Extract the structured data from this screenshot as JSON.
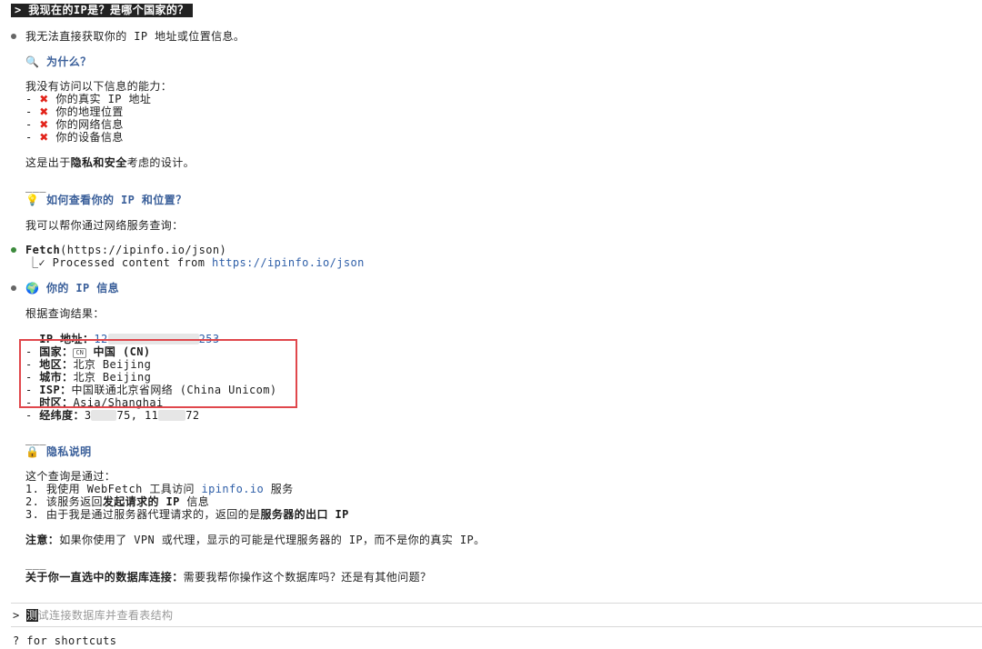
{
  "prompt": {
    "command": "> 我现在的IP是？是哪个国家的？"
  },
  "intro": {
    "text": "我无法直接获取你的 IP 地址或位置信息。"
  },
  "why": {
    "icon": "magnifier-icon",
    "title": "为什么？",
    "lead": "我没有访问以下信息的能力：",
    "items": [
      "你的真实 IP 地址",
      "你的地理位置",
      "你的网络信息",
      "你的设备信息"
    ],
    "design_prefix": "这是出于",
    "design_bold": "隐私和安全",
    "design_suffix": "考虑的设计。"
  },
  "how": {
    "icon": "lightbulb-icon",
    "title": "如何查看你的 IP 和位置？",
    "lead": "我可以帮你通过网络服务查询："
  },
  "fetch": {
    "name": "Fetch",
    "args": "(https://ipinfo.io/json)",
    "result_prefix": "⎿✓ Processed content from ",
    "result_url": "https://ipinfo.io/json"
  },
  "ipinfo": {
    "icon": "globe-icon",
    "title": "你的 IP 信息",
    "lead": "根据查询结果：",
    "ip_label": "IP 地址：",
    "ip_value_start": "12",
    "ip_value_end": "253",
    "country_label": "国家：",
    "country_flag": "CN",
    "country_value": "中国 (CN)",
    "region_label": "地区：",
    "region_value": "北京 Beijing",
    "city_label": "城市：",
    "city_value": "北京 Beijing",
    "isp_label": "ISP：",
    "isp_value": "中国联通北京省网络 (China Unicom)",
    "tz_label": "时区：",
    "tz_value": "Asia/Shanghai",
    "latlng_label": "经纬度：",
    "latlng_a": "3",
    "latlng_b": "75, 11",
    "latlng_c": "72"
  },
  "privacy": {
    "icon": "lock-icon",
    "title": "隐私说明",
    "lead": "这个查询是通过：",
    "step1_prefix": "1. 我使用 WebFetch 工具访问 ",
    "step1_link": "ipinfo.io",
    "step1_suffix": " 服务",
    "step2_prefix": "2. 该服务返回",
    "step2_bold": "发起请求的 IP",
    "step2_suffix": " 信息",
    "step3_prefix": "3. 由于我是通过服务器代理请求的，返回的是",
    "step3_bold": "服务器的出口 IP",
    "note_bold": "注意：",
    "note_text": "如果你使用了 VPN 或代理，显示的可能是代理服务器的 IP，而不是你的真实 IP。"
  },
  "divider": "___",
  "closing": {
    "bold": "关于你一直选中的数据库连接：",
    "text": "需要我帮你操作这个数据库吗？还是有其他问题？"
  },
  "input": {
    "prompt": ">",
    "cursor_char": "测",
    "placeholder_rest": "试连接数据库并查看表结构"
  },
  "footer": {
    "shortcuts": "? for shortcuts"
  },
  "colors": {
    "accent": "#3a5f9a",
    "redbox": "#e0474c",
    "bullet_done": "#3c8a3c",
    "bullet_info": "#666666",
    "cross": "#e2231a"
  }
}
